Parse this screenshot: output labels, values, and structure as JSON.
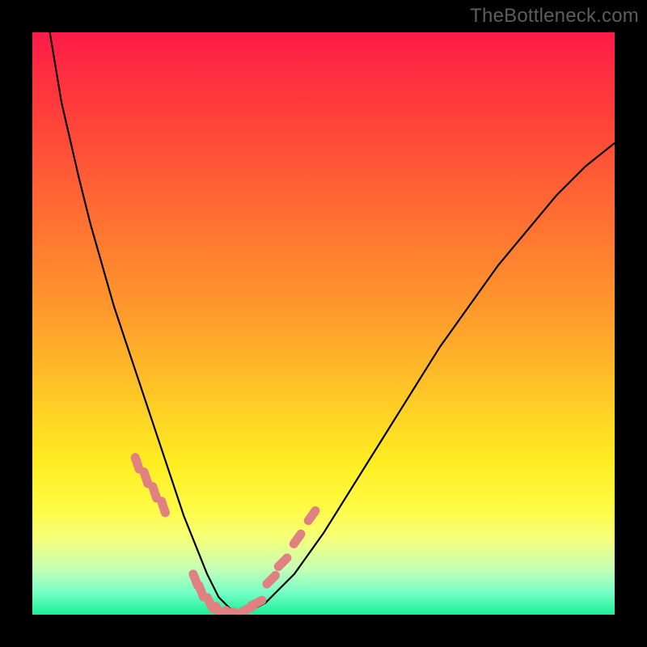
{
  "watermark": "TheBottleneck.com",
  "colors": {
    "frame": "#000000",
    "curve": "#000000",
    "marker": "#e08080",
    "gradient_top": "#ff1b48",
    "gradient_bottom": "#18f09a"
  },
  "chart_data": {
    "type": "line",
    "title": "",
    "xlabel": "",
    "ylabel": "",
    "xlim": [
      0,
      100
    ],
    "ylim": [
      0,
      100
    ],
    "x": [
      3,
      5,
      8,
      10,
      12,
      14,
      16,
      18,
      20,
      22,
      24,
      26,
      28,
      30,
      32,
      34,
      36,
      40,
      45,
      50,
      55,
      60,
      65,
      70,
      75,
      80,
      85,
      90,
      95,
      100
    ],
    "y": [
      100,
      88,
      75,
      67,
      60,
      53,
      47,
      41,
      35,
      29,
      23,
      17,
      12,
      7,
      3,
      1,
      0,
      2,
      7,
      14,
      22,
      30,
      38,
      46,
      53,
      60,
      66,
      72,
      77,
      81
    ],
    "markers_x": [
      18,
      19.5,
      21,
      22.5,
      28,
      29,
      30.5,
      32,
      34,
      35.5,
      37,
      38.5,
      41,
      43,
      45.5,
      48
    ],
    "markers_y": [
      26,
      23.5,
      21,
      18.5,
      6,
      4,
      2,
      0.5,
      0,
      0,
      1,
      2,
      6,
      9,
      13,
      17
    ]
  }
}
